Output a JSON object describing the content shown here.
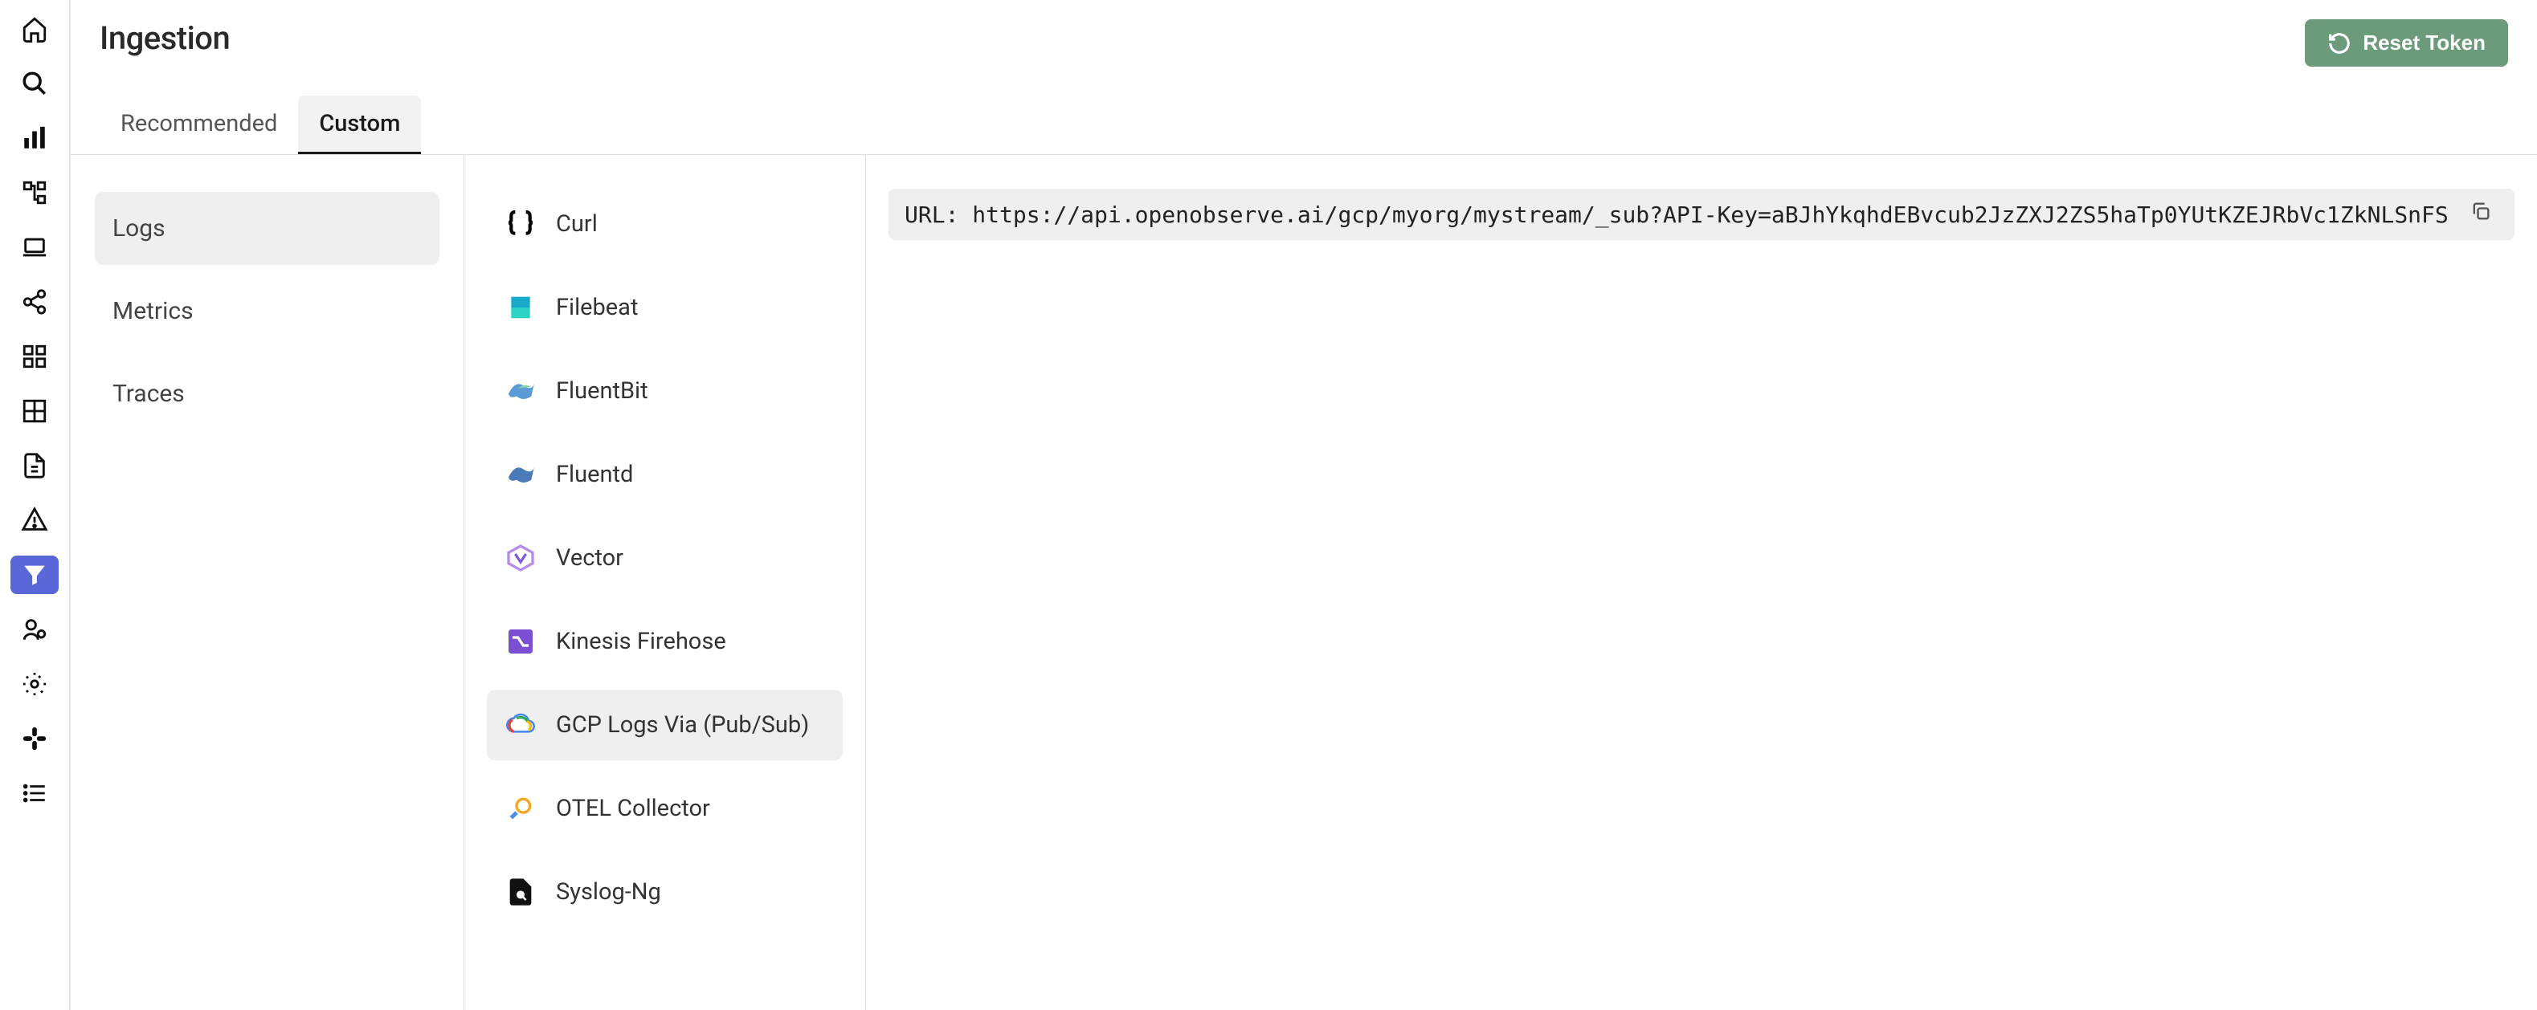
{
  "page": {
    "title": "Ingestion",
    "reset_button": "Reset Token"
  },
  "tabs": [
    {
      "label": "Recommended",
      "active": false
    },
    {
      "label": "Custom",
      "active": true
    }
  ],
  "categories": [
    {
      "label": "Logs",
      "active": true
    },
    {
      "label": "Metrics",
      "active": false
    },
    {
      "label": "Traces",
      "active": false
    }
  ],
  "sources": [
    {
      "label": "Curl",
      "icon": "braces-icon",
      "active": false
    },
    {
      "label": "Filebeat",
      "icon": "filebeat-icon",
      "active": false
    },
    {
      "label": "FluentBit",
      "icon": "fluentbit-icon",
      "active": false
    },
    {
      "label": "Fluentd",
      "icon": "fluentd-icon",
      "active": false
    },
    {
      "label": "Vector",
      "icon": "vector-icon",
      "active": false
    },
    {
      "label": "Kinesis Firehose",
      "icon": "kinesis-icon",
      "active": false
    },
    {
      "label": "GCP Logs Via (Pub/Sub)",
      "icon": "gcp-icon",
      "active": true
    },
    {
      "label": "OTEL Collector",
      "icon": "otel-icon",
      "active": false
    },
    {
      "label": "Syslog-Ng",
      "icon": "syslog-icon",
      "active": false
    }
  ],
  "detail": {
    "url_line": "URL: https://api.openobserve.ai/gcp/myorg/mystream/_sub?API-Key=aBJhYkqhdEBvcub2JzZXJ2ZS5haTp0YUtKZEJRbVc1ZkNLSnFS"
  },
  "sidebar_icons": [
    "home-icon",
    "search-icon",
    "bar-chart-icon",
    "flow-icon",
    "laptop-icon",
    "share-icon",
    "dashboard-icon",
    "grid-icon",
    "file-icon",
    "alert-icon",
    "funnel-icon",
    "user-cog-icon",
    "gear-icon",
    "slack-icon",
    "list-icon"
  ],
  "sidebar_active_index": 10
}
